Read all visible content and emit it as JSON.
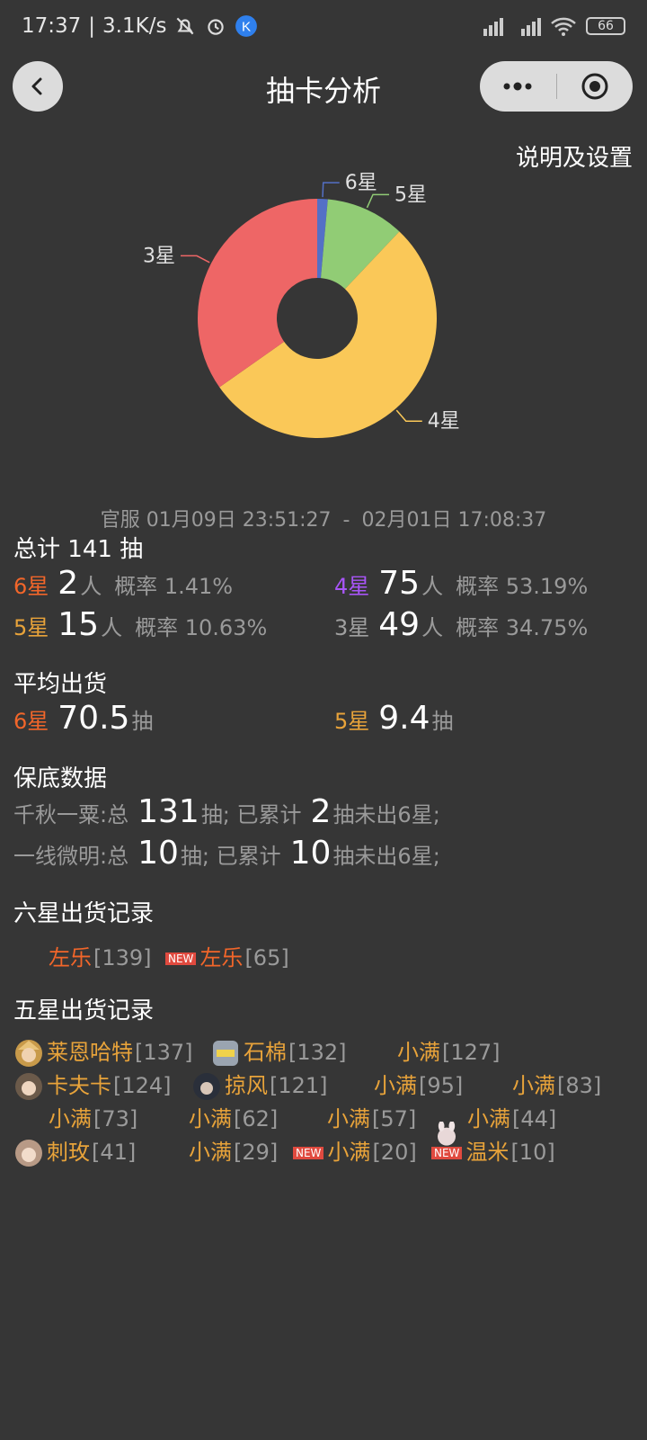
{
  "status_bar": {
    "time": "17:37",
    "speed": "3.1K/s",
    "battery": "66"
  },
  "nav": {
    "title": "抽卡分析"
  },
  "settings_link": "说明及设置",
  "chart_data": {
    "type": "pie",
    "categories": [
      "6星",
      "5星",
      "4星",
      "3星"
    ],
    "values": [
      2,
      15,
      75,
      49
    ],
    "colors": [
      "#5470c6",
      "#91cc75",
      "#fac858",
      "#ee6666"
    ],
    "donut": true
  },
  "time_range": {
    "server": "官服",
    "start": "01月09日 23:51:27",
    "sep": "-",
    "end": "02月01日 17:08:37"
  },
  "total": {
    "prefix": "总计",
    "count": "141",
    "suffix": "抽"
  },
  "stats": [
    {
      "star": "6星",
      "count": "2",
      "unit": "人",
      "rate_label": "概率",
      "rate": "1.41%"
    },
    {
      "star": "4星",
      "count": "75",
      "unit": "人",
      "rate_label": "概率",
      "rate": "53.19%"
    },
    {
      "star": "5星",
      "count": "15",
      "unit": "人",
      "rate_label": "概率",
      "rate": "10.63%"
    },
    {
      "star": "3星",
      "count": "49",
      "unit": "人",
      "rate_label": "概率",
      "rate": "34.75%"
    }
  ],
  "average": {
    "title": "平均出货",
    "six": {
      "star": "6星",
      "value": "70.5",
      "unit": "抽"
    },
    "five": {
      "star": "5星",
      "value": "9.4",
      "unit": "抽"
    }
  },
  "pity": {
    "title": "保底数据",
    "rows": [
      {
        "pool": "千秋一粟:总",
        "total": "131",
        "mid": "抽; 已累计",
        "since": "2",
        "tail": "抽未出6星;"
      },
      {
        "pool": "一线微明:总",
        "total": "10",
        "mid": "抽; 已累计",
        "since": "10",
        "tail": "抽未出6星;"
      }
    ]
  },
  "six_records": {
    "title": "六星出货记录",
    "items": [
      {
        "name": "左乐",
        "pull": "[139]",
        "new": ""
      },
      {
        "name": "左乐",
        "pull": "[65]",
        "new": "NEW"
      }
    ]
  },
  "five_records": {
    "title": "五星出货记录",
    "items": [
      {
        "name": "莱恩哈特",
        "pull": "[137]",
        "new": "",
        "avatar": "reinhart-avatar-icon"
      },
      {
        "name": "石棉",
        "pull": "[132]",
        "new": "",
        "avatar": "asbestos-avatar-icon"
      },
      {
        "name": "小满",
        "pull": "[127]",
        "new": ""
      },
      {
        "name": "卡夫卡",
        "pull": "[124]",
        "new": "",
        "avatar": "kafka-avatar-icon"
      },
      {
        "name": "掠风",
        "pull": "[121]",
        "new": "",
        "avatar": "windflit-avatar-icon"
      },
      {
        "name": "小满",
        "pull": "[95]",
        "new": ""
      },
      {
        "name": "小满",
        "pull": "[83]",
        "new": ""
      },
      {
        "name": "小满",
        "pull": "[73]",
        "new": ""
      },
      {
        "name": "小满",
        "pull": "[62]",
        "new": ""
      },
      {
        "name": "小满",
        "pull": "[57]",
        "new": ""
      },
      {
        "name": "小满",
        "pull": "[44]",
        "new": ""
      },
      {
        "name": "刺玫",
        "pull": "[41]",
        "new": "",
        "avatar": "ciwei-avatar-icon"
      },
      {
        "name": "小满",
        "pull": "[29]",
        "new": ""
      },
      {
        "name": "小满",
        "pull": "[20]",
        "new": "NEW"
      },
      {
        "name": "温米",
        "pull": "[10]",
        "new": "NEW",
        "avatar": "warmy-avatar-icon"
      }
    ]
  }
}
